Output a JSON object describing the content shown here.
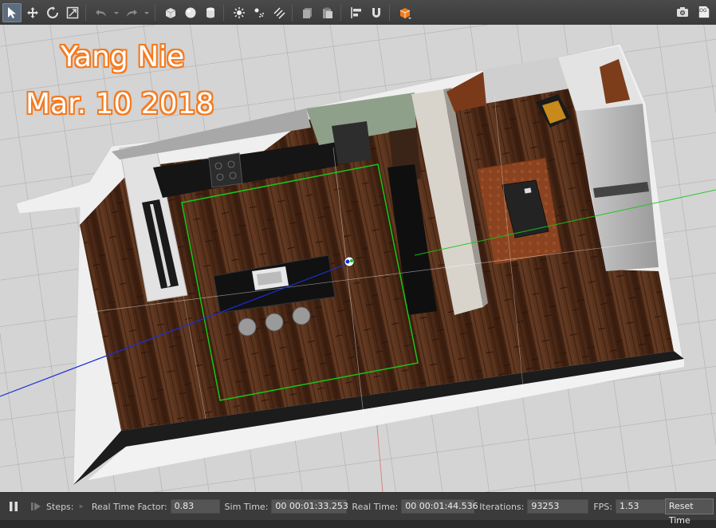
{
  "toolbar": {
    "left_icons": [
      "select-arrow-icon",
      "translate-icon",
      "rotate-icon",
      "scale-icon",
      "undo-icon",
      "undo-dropdown-icon",
      "redo-icon",
      "redo-dropdown-icon",
      "box-shape-icon",
      "sphere-shape-icon",
      "cylinder-shape-icon",
      "point-light-icon",
      "spot-light-icon",
      "directional-light-icon",
      "copy-icon",
      "paste-icon",
      "align-icon",
      "snap-magnet-icon",
      "view-angle-cube-icon"
    ],
    "right_icons": [
      "screenshot-camera-icon",
      "log-icon"
    ],
    "log_label": "LOG"
  },
  "overlay": {
    "name": "Yang Nie",
    "date": "Mar. 10 2018"
  },
  "status": {
    "steps_label": "Steps:",
    "real_time_factor_label": "Real Time Factor:",
    "real_time_factor": "0.83",
    "sim_time_label": "Sim Time:",
    "sim_time": "00 00:01:33.253",
    "real_time_label": "Real Time:",
    "real_time": "00 00:01:44.536",
    "iterations_label": "Iterations:",
    "iterations": "93253",
    "fps_label": "FPS:",
    "fps": "1.53",
    "reset_label": "Reset Time"
  },
  "colors": {
    "toolbar_bg": "#3f3f3f",
    "ground": "#d2d2d2",
    "floor": "#4a2a18",
    "wall": "#e8e8e8",
    "selection": "#16c616",
    "overlay_outline": "#f47a1f"
  }
}
